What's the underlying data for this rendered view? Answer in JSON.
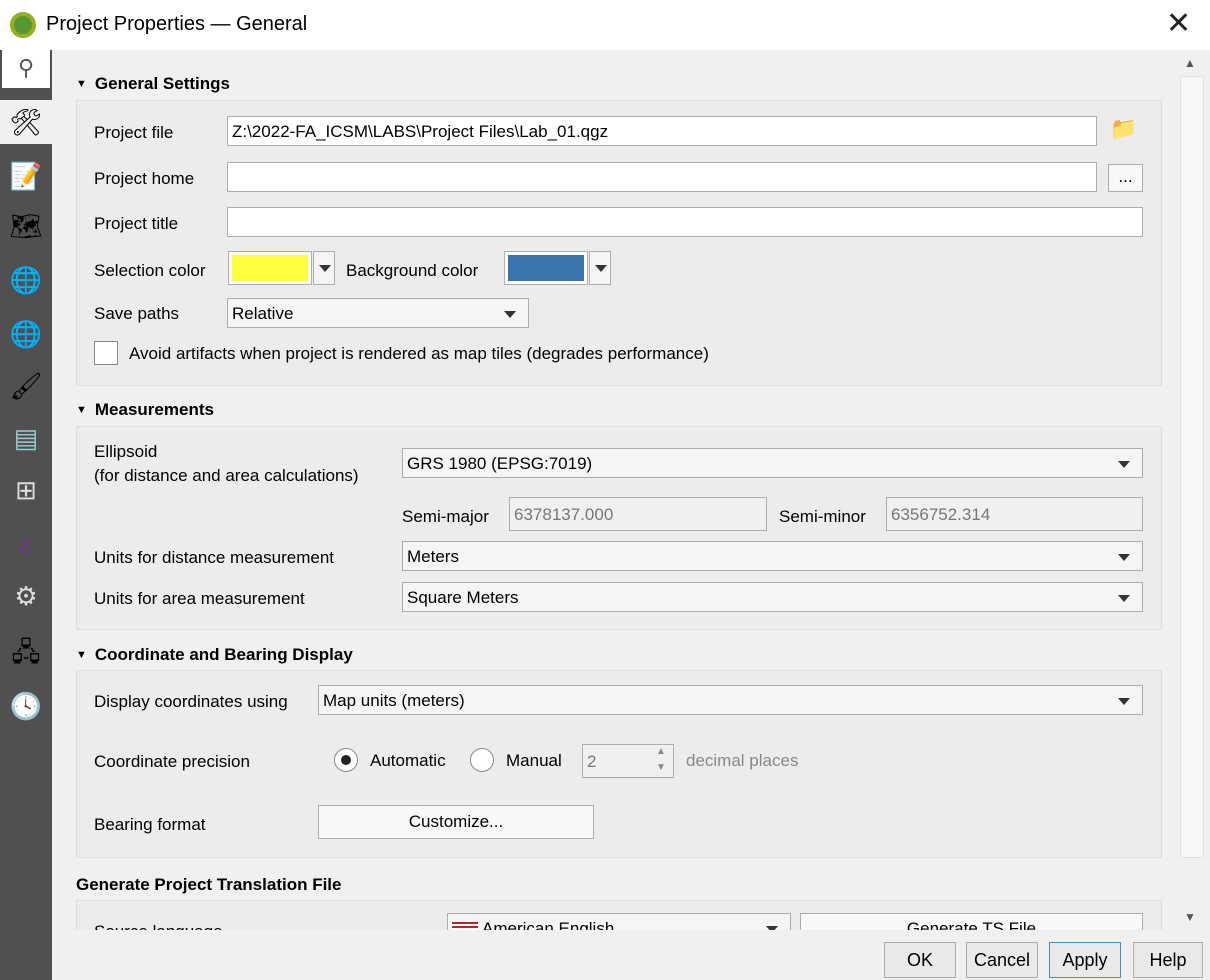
{
  "window": {
    "title": "Project Properties — General"
  },
  "sidebar": {
    "items": [
      "general",
      "metadata",
      "view-settings",
      "crs",
      "transformations",
      "styles",
      "data-sources",
      "relations",
      "variables",
      "macros",
      "qgis-server",
      "temporal"
    ]
  },
  "general": {
    "heading": "General Settings",
    "project_file_label": "Project file",
    "project_file_value": "Z:\\2022-FA_ICSM\\LABS\\Project Files\\Lab_01.qgz",
    "project_home_label": "Project home",
    "project_home_value": "",
    "browse_label": "...",
    "project_title_label": "Project title",
    "project_title_value": "",
    "selection_color_label": "Selection color",
    "selection_color": "#ffff40",
    "background_color_label": "Background color",
    "background_color": "#3a75b0",
    "save_paths_label": "Save paths",
    "save_paths_value": "Relative",
    "avoid_artifacts_label": "Avoid artifacts when project is rendered as map tiles (degrades performance)",
    "avoid_artifacts_checked": false
  },
  "measurements": {
    "heading": "Measurements",
    "ellipsoid_label": "Ellipsoid",
    "ellipsoid_sublabel": "(for distance and area calculations)",
    "ellipsoid_value": "GRS 1980 (EPSG:7019)",
    "semi_major_label": "Semi-major",
    "semi_major_value": "6378137.000",
    "semi_minor_label": "Semi-minor",
    "semi_minor_value": "6356752.314",
    "distance_label": "Units for distance measurement",
    "distance_value": "Meters",
    "area_label": "Units for area measurement",
    "area_value": "Square Meters"
  },
  "coordinates": {
    "heading": "Coordinate and Bearing Display",
    "display_label": "Display coordinates using",
    "display_value": "Map units (meters)",
    "precision_label": "Coordinate precision",
    "automatic_label": "Automatic",
    "manual_label": "Manual",
    "precision_value": "2",
    "decimal_label": "decimal places",
    "bearing_label": "Bearing format",
    "customize_label": "Customize..."
  },
  "translation": {
    "heading": "Generate Project Translation File",
    "source_language_label": "Source language",
    "source_language_value": "American English",
    "generate_label": "Generate TS File"
  },
  "buttons": {
    "ok": "OK",
    "cancel": "Cancel",
    "apply": "Apply",
    "help": "Help"
  }
}
